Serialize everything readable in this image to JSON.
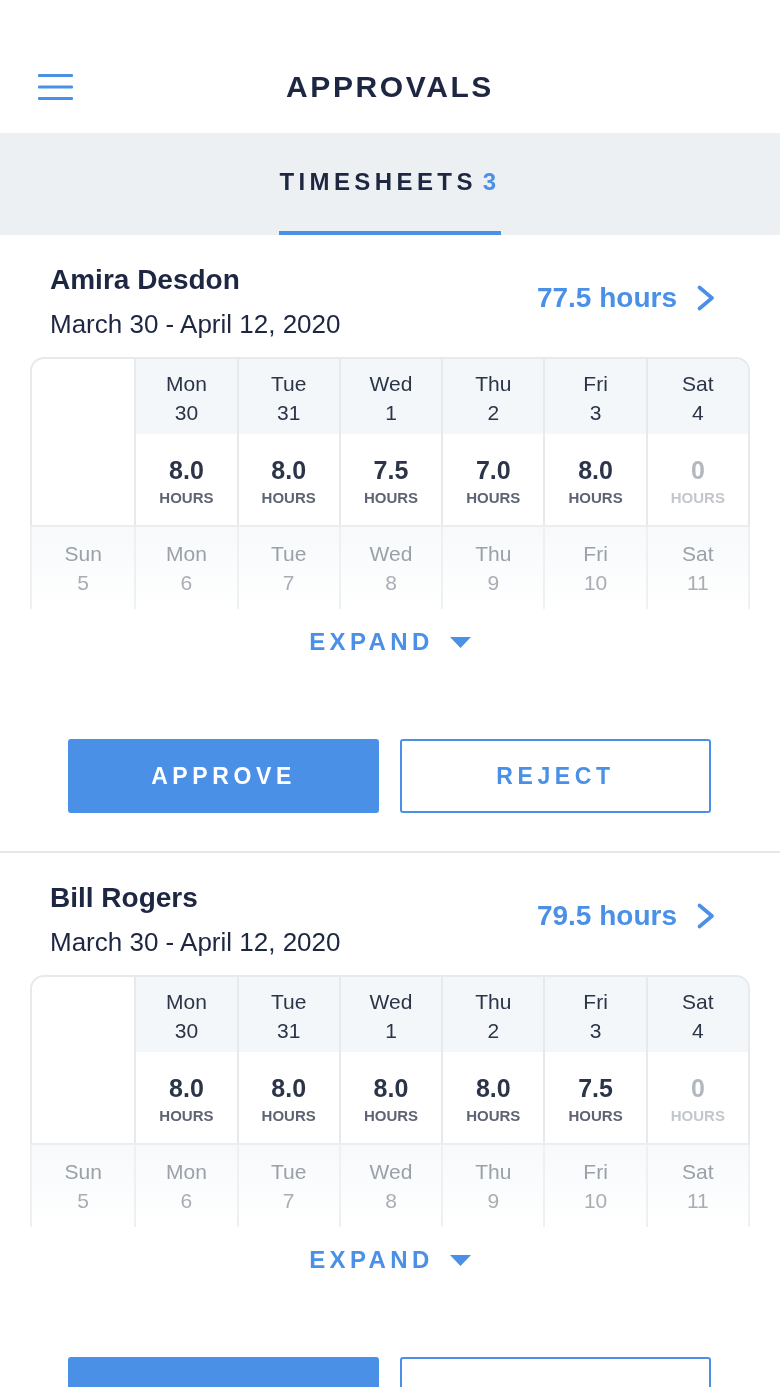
{
  "header": {
    "title": "APPROVALS"
  },
  "tabs": [
    {
      "label": "TIMESHEETS",
      "count": "3",
      "selected": true
    }
  ],
  "timesheets": [
    {
      "name": "Amira Desdon",
      "period": "March 30 - April 12, 2020",
      "total": "77.5 hours",
      "week_1": [
        {
          "day": "Mon",
          "date": "30",
          "hours": "8.0",
          "unit": "HOURS",
          "dimmed": false
        },
        {
          "day": "Tue",
          "date": "31",
          "hours": "8.0",
          "unit": "HOURS",
          "dimmed": false
        },
        {
          "day": "Wed",
          "date": "1",
          "hours": "7.5",
          "unit": "HOURS",
          "dimmed": false
        },
        {
          "day": "Thu",
          "date": "2",
          "hours": "7.0",
          "unit": "HOURS",
          "dimmed": false
        },
        {
          "day": "Fri",
          "date": "3",
          "hours": "8.0",
          "unit": "HOURS",
          "dimmed": false
        },
        {
          "day": "Sat",
          "date": "4",
          "hours": "0",
          "unit": "HOURS",
          "dimmed": true
        }
      ],
      "week_2": [
        {
          "day": "Sun",
          "date": "5"
        },
        {
          "day": "Mon",
          "date": "6"
        },
        {
          "day": "Tue",
          "date": "7"
        },
        {
          "day": "Wed",
          "date": "8"
        },
        {
          "day": "Thu",
          "date": "9"
        },
        {
          "day": "Fri",
          "date": "10"
        },
        {
          "day": "Sat",
          "date": "11"
        }
      ],
      "expand": {
        "label": "EXPAND",
        "expanded": false
      },
      "actions": [
        {
          "kind": "approve",
          "label": "APPROVE"
        },
        {
          "kind": "reject",
          "label": "REJECT"
        }
      ]
    },
    {
      "name": "Bill Rogers",
      "period": "March 30 - April 12, 2020",
      "total": "79.5 hours",
      "week_1": [
        {
          "day": "Mon",
          "date": "30",
          "hours": "8.0",
          "unit": "HOURS",
          "dimmed": false
        },
        {
          "day": "Tue",
          "date": "31",
          "hours": "8.0",
          "unit": "HOURS",
          "dimmed": false
        },
        {
          "day": "Wed",
          "date": "1",
          "hours": "8.0",
          "unit": "HOURS",
          "dimmed": false
        },
        {
          "day": "Thu",
          "date": "2",
          "hours": "8.0",
          "unit": "HOURS",
          "dimmed": false
        },
        {
          "day": "Fri",
          "date": "3",
          "hours": "7.5",
          "unit": "HOURS",
          "dimmed": false
        },
        {
          "day": "Sat",
          "date": "4",
          "hours": "0",
          "unit": "HOURS",
          "dimmed": true
        }
      ],
      "week_2": [
        {
          "day": "Sun",
          "date": "5"
        },
        {
          "day": "Mon",
          "date": "6"
        },
        {
          "day": "Tue",
          "date": "7"
        },
        {
          "day": "Wed",
          "date": "8"
        },
        {
          "day": "Thu",
          "date": "9"
        },
        {
          "day": "Fri",
          "date": "10"
        },
        {
          "day": "Sat",
          "date": "11"
        }
      ],
      "expand": {
        "label": "EXPAND",
        "expanded": false
      },
      "actions": [
        {
          "kind": "approve"
        },
        {
          "kind": "reject"
        }
      ]
    }
  ]
}
